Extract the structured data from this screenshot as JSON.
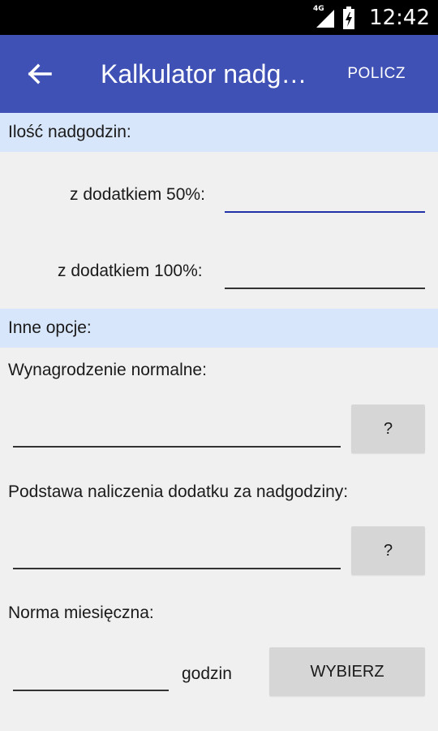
{
  "statusbar": {
    "network": "4G",
    "time": "12:42"
  },
  "appbar": {
    "title": "Kalkulator nadgodzin",
    "action_label": "POLICZ"
  },
  "sections": {
    "overtime_header": "Ilość nadgodzin:",
    "other_header": "Inne opcje:"
  },
  "overtime": {
    "label_50": "z dodatkiem 50%:",
    "value_50": "",
    "label_100": "z dodatkiem 100%:",
    "value_100": ""
  },
  "options": {
    "salary_label": "Wynagrodzenie normalne:",
    "salary_value": "",
    "salary_help": "?",
    "base_label": "Podstawa naliczenia dodatku za nadgodziny:",
    "base_value": "",
    "base_help": "?",
    "norm_label": "Norma miesięczna:",
    "norm_value": "",
    "norm_unit": "godzin",
    "choose_label": "WYBIERZ"
  }
}
